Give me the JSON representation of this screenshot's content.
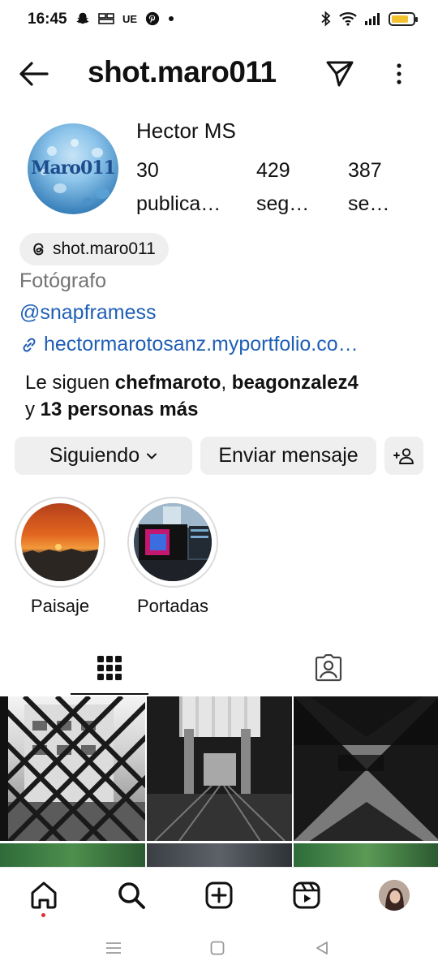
{
  "status_bar": {
    "time": "16:45",
    "left_icons": [
      "snapchat-icon",
      "tenki-icon",
      "ue-label",
      "pinterest-icon",
      "dot"
    ],
    "ue_label": "UE",
    "right_icons": [
      "bluetooth-icon",
      "wifi-icon",
      "signal-icon",
      "battery-icon"
    ],
    "battery_color": "#f2c12e"
  },
  "header": {
    "username": "shot.maro011"
  },
  "profile": {
    "display_name": "Hector MS",
    "avatar_text": "Maro011",
    "stats": [
      {
        "value": "30",
        "label": "publica…"
      },
      {
        "value": "429",
        "label": "seg…"
      },
      {
        "value": "387",
        "label": "se…"
      }
    ],
    "threads_handle": "shot.maro011",
    "category": "Fotógrafo",
    "mention": "@snapframess",
    "link": "hectormarotosanz.myportfolio.co…",
    "followed_by_prefix": "Le siguen ",
    "followed_by_user1": "chefmaroto",
    "followed_by_sep": ", ",
    "followed_by_user2": "beagonzalez4",
    "followed_by_line2_prefix": "y ",
    "followed_by_line2_bold": "13 personas más"
  },
  "actions": {
    "following_label": "Siguiendo",
    "message_label": "Enviar mensaje"
  },
  "highlights": [
    {
      "label": "Paisaje"
    },
    {
      "label": "Portadas"
    }
  ],
  "tabs": [
    "grid-icon",
    "tagged-icon"
  ],
  "bottom_nav": [
    "home-icon",
    "search-icon",
    "create-icon",
    "reels-icon",
    "profile-avatar"
  ],
  "colors": {
    "link_blue": "#1f5fb5",
    "muted_gray": "#737373",
    "button_bg": "#efefef",
    "notification_dot": "#e02e2e"
  }
}
